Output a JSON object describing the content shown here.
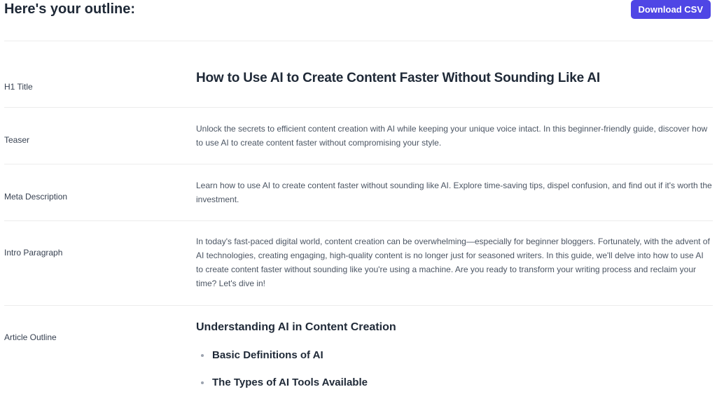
{
  "header": {
    "title": "Here's your outline:",
    "download_label": "Download CSV",
    "accent_color": "#4f46e5"
  },
  "rows": [
    {
      "label": "H1 Title",
      "content": "How to Use AI to Create Content Faster Without Sounding Like AI"
    },
    {
      "label": "Teaser",
      "content": "Unlock the secrets to efficient content creation with AI while keeping your unique voice intact. In this beginner-friendly guide, discover how to use AI to create content faster without compromising your style."
    },
    {
      "label": "Meta Description",
      "content": "Learn how to use AI to create content faster without sounding like AI. Explore time-saving tips, dispel confusion, and find out if it's worth the investment."
    },
    {
      "label": "Intro Paragraph",
      "content": "In today's fast-paced digital world, content creation can be overwhelming—especially for beginner bloggers. Fortunately, with the advent of AI technologies, creating engaging, high-quality content is no longer just for seasoned writers. In this guide, we'll delve into how to use AI to create content faster without sounding like you're using a machine. Are you ready to transform your writing process and reclaim your time? Let's dive in!"
    },
    {
      "label": "Article Outline",
      "section_heading": "Understanding AI in Content Creation",
      "items": [
        "Basic Definitions of AI",
        "The Types of AI Tools Available"
      ]
    }
  ]
}
